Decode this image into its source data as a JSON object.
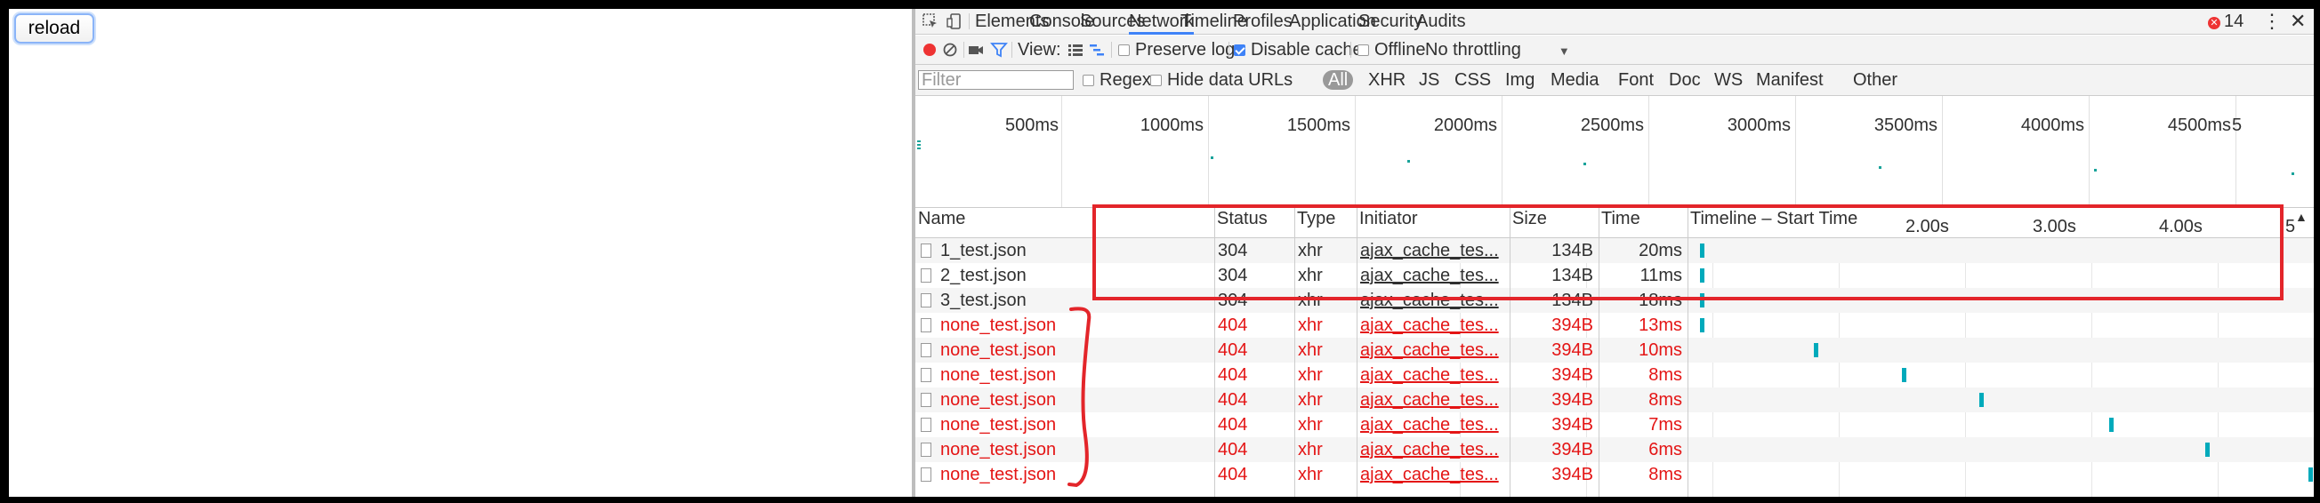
{
  "page": {
    "reload_label": "reload"
  },
  "devtools": {
    "tabs": [
      "Elements",
      "Console",
      "Sources",
      "Network",
      "Timeline",
      "Profiles",
      "Application",
      "Security",
      "Audits"
    ],
    "active_tab": "Network",
    "error_count": "14",
    "menu_glyph": "⋮",
    "close_glyph": "✕",
    "toolbar": {
      "view_label": "View:",
      "preserve_log": {
        "label": "Preserve log",
        "checked": false
      },
      "disable_cache": {
        "label": "Disable cache",
        "checked": true
      },
      "offline": {
        "label": "Offline",
        "checked": false
      },
      "throttling": "No throttling",
      "dropdown_glyph": "▼"
    },
    "filterbar": {
      "placeholder": "Filter",
      "regex_label": "Regex",
      "hide_data_urls_label": "Hide data URLs",
      "types": [
        "All",
        "XHR",
        "JS",
        "CSS",
        "Img",
        "Media",
        "Font",
        "Doc",
        "WS",
        "Manifest",
        "Other"
      ],
      "active_type": "All"
    },
    "overview": {
      "ticks": [
        "500ms",
        "1000ms",
        "1500ms",
        "2000ms",
        "2500ms",
        "3000ms",
        "3500ms",
        "4000ms",
        "4500ms"
      ],
      "tick_fifth": "5"
    },
    "table": {
      "headers": {
        "name": "Name",
        "status": "Status",
        "type": "Type",
        "initiator": "Initiator",
        "size": "Size",
        "time": "Time",
        "timeline": "Timeline – Start Time"
      },
      "timeline_ticks": [
        "2.00s",
        "3.00s",
        "4.00s",
        "5"
      ],
      "sort_glyph": "▲",
      "rows": [
        {
          "name": "1_test.json",
          "status": "304",
          "type": "xhr",
          "initiator": "ajax_cache_tes...",
          "size": "134B",
          "time": "20ms",
          "error": false
        },
        {
          "name": "2_test.json",
          "status": "304",
          "type": "xhr",
          "initiator": "ajax_cache_tes...",
          "size": "134B",
          "time": "11ms",
          "error": false
        },
        {
          "name": "3_test.json",
          "status": "304",
          "type": "xhr",
          "initiator": "ajax_cache_tes...",
          "size": "134B",
          "time": "18ms",
          "error": false
        },
        {
          "name": "none_test.json",
          "status": "404",
          "type": "xhr",
          "initiator": "ajax_cache_tes...",
          "size": "394B",
          "time": "13ms",
          "error": true
        },
        {
          "name": "none_test.json",
          "status": "404",
          "type": "xhr",
          "initiator": "ajax_cache_tes...",
          "size": "394B",
          "time": "10ms",
          "error": true
        },
        {
          "name": "none_test.json",
          "status": "404",
          "type": "xhr",
          "initiator": "ajax_cache_tes...",
          "size": "394B",
          "time": "8ms",
          "error": true
        },
        {
          "name": "none_test.json",
          "status": "404",
          "type": "xhr",
          "initiator": "ajax_cache_tes...",
          "size": "394B",
          "time": "8ms",
          "error": true
        },
        {
          "name": "none_test.json",
          "status": "404",
          "type": "xhr",
          "initiator": "ajax_cache_tes...",
          "size": "394B",
          "time": "7ms",
          "error": true
        },
        {
          "name": "none_test.json",
          "status": "404",
          "type": "xhr",
          "initiator": "ajax_cache_tes...",
          "size": "394B",
          "time": "6ms",
          "error": true
        },
        {
          "name": "none_test.json",
          "status": "404",
          "type": "xhr",
          "initiator": "ajax_cache_tes...",
          "size": "394B",
          "time": "8ms",
          "error": true
        }
      ]
    }
  },
  "colors": {
    "error_text": "#e41515",
    "annotation": "#e3252a",
    "accent": "#3e82f7",
    "bar": "#00aabb",
    "record": "#e33333"
  }
}
